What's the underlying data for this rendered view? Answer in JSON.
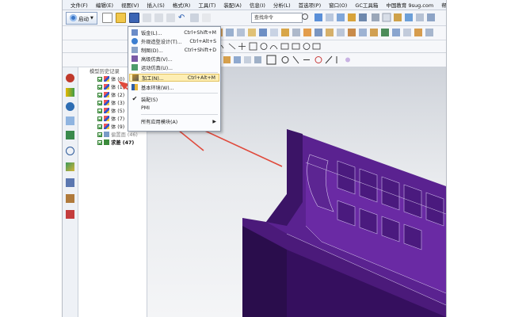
{
  "menubar": {
    "items": [
      "文件(F)",
      "编辑(E)",
      "视图(V)",
      "插入(S)",
      "格式(R)",
      "工具(T)",
      "装配(A)",
      "信息(I)",
      "分析(L)",
      "首选项(P)",
      "窗口(O)",
      "GC工具箱",
      "中国教育 9sug.com",
      "帮助(H)"
    ]
  },
  "toolbar": {
    "start_label": "启动",
    "command_search_placeholder": "查找命令"
  },
  "app_menu": {
    "items": [
      {
        "label": "钣金(L)...",
        "shortcut": "Ctrl+Shift+M",
        "icon": "sheet-metal-icon"
      },
      {
        "label": "外观造型设计(T)...",
        "shortcut": "Ctrl+Alt+S",
        "icon": "shape-studio-icon"
      },
      {
        "label": "制图(D)...",
        "shortcut": "Ctrl+Shift+D",
        "icon": "drafting-icon"
      },
      {
        "label": "高级仿真(V)...",
        "shortcut": "",
        "icon": "advanced-simulation-icon"
      },
      {
        "label": "运动仿真(U)...",
        "shortcut": "",
        "icon": "motion-simulation-icon"
      },
      {
        "label": "加工(N)...",
        "shortcut": "Ctrl+Alt+M",
        "icon": "manufacturing-icon"
      },
      {
        "label": "基本环境(W)...",
        "shortcut": "",
        "icon": "gateway-icon"
      },
      {
        "label": "装配(S)",
        "shortcut": "",
        "icon": "check-icon"
      },
      {
        "label": "PMI",
        "shortcut": "",
        "icon": ""
      },
      {
        "label": "所有应用模块(A)",
        "shortcut": "",
        "icon": ""
      }
    ]
  },
  "nav_tree": {
    "partial_header": "模型历史记录",
    "items": [
      {
        "label": "体 (0)",
        "style": "normal"
      },
      {
        "label": "体 (1)",
        "style": "normal"
      },
      {
        "label": "体 (2)",
        "style": "normal"
      },
      {
        "label": "体 (3)",
        "style": "normal"
      },
      {
        "label": "体 (5)",
        "style": "normal"
      },
      {
        "label": "体 (7)",
        "style": "normal"
      },
      {
        "label": "体 (9)",
        "style": "normal"
      },
      {
        "label": "偏置面 (46)",
        "style": "faded"
      },
      {
        "label": "求差 (47)",
        "style": "strong"
      }
    ]
  },
  "colors": {
    "model_top": "#5a2290",
    "model_side": "#3b1466",
    "model_dark": "#1f0a38",
    "annotation_arrow": "#e04a3c",
    "highlight": "#fdeeb4"
  }
}
